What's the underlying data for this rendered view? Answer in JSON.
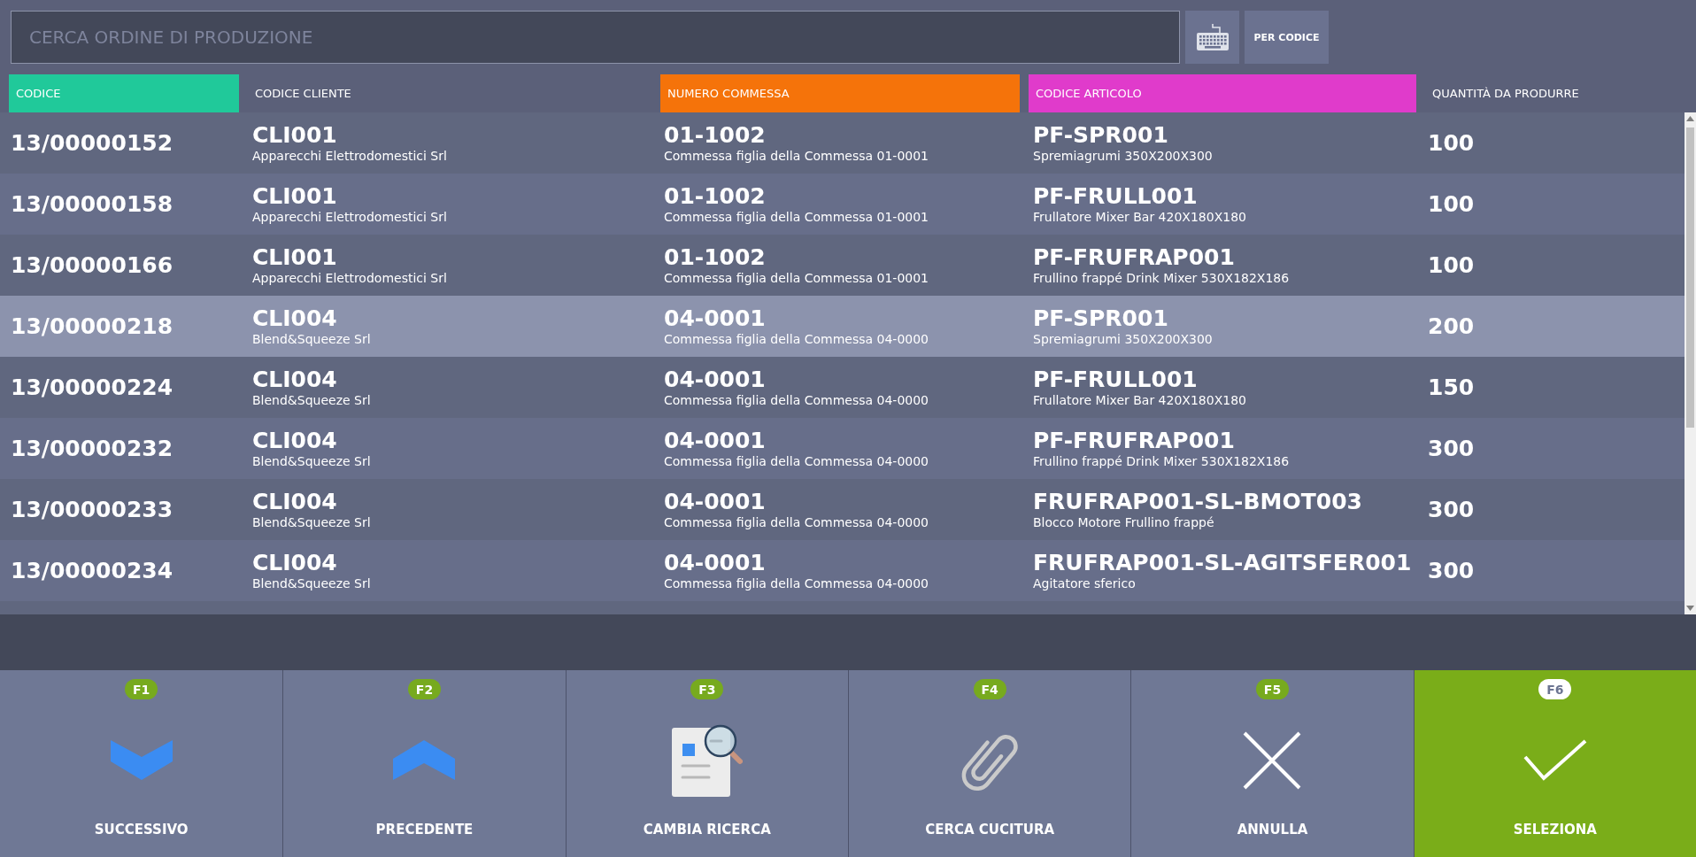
{
  "search": {
    "placeholder": "CERCA ORDINE DI PRODUZIONE"
  },
  "search_mode_button": {
    "label": "PER CODICE"
  },
  "table": {
    "columns": [
      {
        "label": "CODICE",
        "color": "#20c99a"
      },
      {
        "label": "CODICE CLIENTE"
      },
      {
        "label": "NUMERO COMMESSA",
        "color": "#f5730a"
      },
      {
        "label": "CODICE ARTICOLO",
        "color": "#e03bcb"
      },
      {
        "label": "QUANTITÀ DA PRODURRE"
      }
    ],
    "rows": [
      {
        "code": "13/00000152",
        "customer_code": "CLI001",
        "customer_name": "Apparecchi Elettrodomestici Srl",
        "job_number": "01-1002",
        "job_description": "Commessa figlia della Commessa 01-0001",
        "article_code": "PF-SPR001",
        "article_description": "Spremiagrumi 350X200X300",
        "quantity": "100",
        "selected": false
      },
      {
        "code": "13/00000158",
        "customer_code": "CLI001",
        "customer_name": "Apparecchi Elettrodomestici Srl",
        "job_number": "01-1002",
        "job_description": "Commessa figlia della Commessa 01-0001",
        "article_code": "PF-FRULL001",
        "article_description": "Frullatore Mixer Bar 420X180X180",
        "quantity": "100",
        "selected": false
      },
      {
        "code": "13/00000166",
        "customer_code": "CLI001",
        "customer_name": "Apparecchi Elettrodomestici Srl",
        "job_number": "01-1002",
        "job_description": "Commessa figlia della Commessa 01-0001",
        "article_code": "PF-FRUFRAP001",
        "article_description": "Frullino frappé Drink Mixer 530X182X186",
        "quantity": "100",
        "selected": false
      },
      {
        "code": "13/00000218",
        "customer_code": "CLI004",
        "customer_name": "Blend&Squeeze Srl",
        "job_number": "04-0001",
        "job_description": "Commessa figlia della Commessa 04-0000",
        "article_code": "PF-SPR001",
        "article_description": "Spremiagrumi 350X200X300",
        "quantity": "200",
        "selected": true
      },
      {
        "code": "13/00000224",
        "customer_code": "CLI004",
        "customer_name": "Blend&Squeeze Srl",
        "job_number": "04-0001",
        "job_description": "Commessa figlia della Commessa 04-0000",
        "article_code": "PF-FRULL001",
        "article_description": "Frullatore Mixer Bar 420X180X180",
        "quantity": "150",
        "selected": false
      },
      {
        "code": "13/00000232",
        "customer_code": "CLI004",
        "customer_name": "Blend&Squeeze Srl",
        "job_number": "04-0001",
        "job_description": "Commessa figlia della Commessa 04-0000",
        "article_code": "PF-FRUFRAP001",
        "article_description": "Frullino frappé Drink Mixer 530X182X186",
        "quantity": "300",
        "selected": false
      },
      {
        "code": "13/00000233",
        "customer_code": "CLI004",
        "customer_name": "Blend&Squeeze Srl",
        "job_number": "04-0001",
        "job_description": "Commessa figlia della Commessa 04-0000",
        "article_code": "FRUFRAP001-SL-BMOT003",
        "article_description": "Blocco Motore Frullino frappé",
        "quantity": "300",
        "selected": false
      },
      {
        "code": "13/00000234",
        "customer_code": "CLI004",
        "customer_name": "Blend&Squeeze Srl",
        "job_number": "04-0001",
        "job_description": "Commessa figlia della Commessa 04-0000",
        "article_code": "FRUFRAP001-SL-AGITSFER001",
        "article_description": "Agitatore sferico",
        "quantity": "300",
        "selected": false
      }
    ]
  },
  "function_keys": [
    {
      "key": "F1",
      "label": "SUCCESSIVO",
      "primary": false
    },
    {
      "key": "F2",
      "label": "PRECEDENTE",
      "primary": false
    },
    {
      "key": "F3",
      "label": "CAMBIA RICERCA",
      "primary": false
    },
    {
      "key": "F4",
      "label": "CERCA CUCITURA",
      "primary": false
    },
    {
      "key": "F5",
      "label": "ANNULLA",
      "primary": false
    },
    {
      "key": "F6",
      "label": "SELEZIONA",
      "primary": true
    }
  ]
}
